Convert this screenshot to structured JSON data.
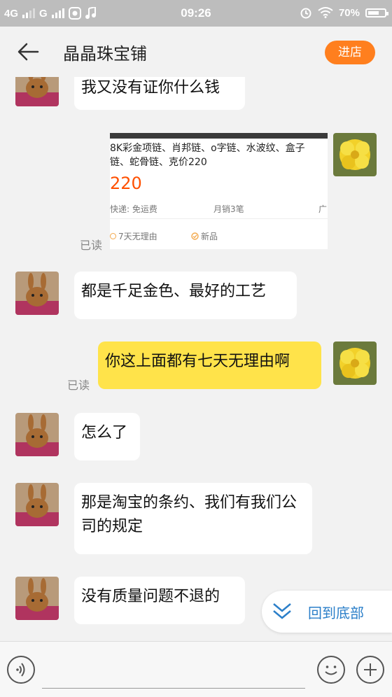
{
  "status_bar": {
    "network_1": "4G",
    "network_2": "G",
    "time": "09:26",
    "battery": "70%",
    "battery_level": 0.7
  },
  "header": {
    "title": "晶晶珠宝铺",
    "enter_shop_label": "进店"
  },
  "messages": [
    {
      "from": "shop",
      "text": "我又没有证你什么钱"
    },
    {
      "from": "me",
      "type": "product_card"
    },
    {
      "from": "shop",
      "text": "都是千足金色、最好的工艺"
    },
    {
      "from": "me",
      "text": "你这上面都有七天无理由啊",
      "read_label": "已读"
    },
    {
      "from": "shop",
      "text": "怎么了"
    },
    {
      "from": "shop",
      "text": "那是淘宝的条约、我们有我们公司的规定"
    },
    {
      "from": "shop",
      "text": "没有质量问题不退的"
    }
  ],
  "product_card": {
    "title": "8K彩金项链、肖邦链、o字链、水波纹、盒子链、蛇骨链、克价220",
    "price": "220",
    "shipping": "快递: 免运费",
    "sales": "月销3笔",
    "location": "广",
    "guarantee": "7天无理由",
    "condition": "新品",
    "read_label": "已读"
  },
  "back_to_bottom_label": "回到底部",
  "input": {
    "value": ""
  },
  "colors": {
    "accent": "#ff7f1e",
    "my_bubble": "#ffe34a",
    "price": "#ff5000",
    "link": "#2b7fc9"
  }
}
